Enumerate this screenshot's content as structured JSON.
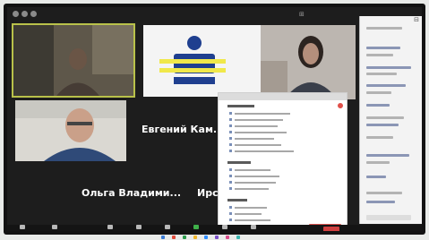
{
  "meeting": {
    "view_label": "⊞",
    "participants": [
      {
        "tile_name": "",
        "big_name": ""
      },
      {
        "tile_name": "",
        "big_name": "Евгений  Кам..."
      },
      {
        "tile_name": "",
        "big_name": ""
      },
      {
        "tile_name": "",
        "big_name": ""
      }
    ],
    "lower_names": {
      "left": "Ольга Владими...",
      "right": "Ирс"
    }
  },
  "chat": {
    "title": "⊟"
  },
  "toolbar": {
    "items": [
      {
        "icon": "microphone-icon"
      },
      {
        "icon": "video-camera-icon"
      },
      {
        "icon": "security-icon"
      },
      {
        "icon": "participants-icon"
      },
      {
        "icon": "chat-icon"
      },
      {
        "icon": "share-screen-icon"
      },
      {
        "icon": "record-icon"
      },
      {
        "icon": "reactions-icon"
      }
    ]
  },
  "colors": {
    "tile_border_active": "#b9c14a",
    "logo_blue": "#1f3f8f",
    "logo_yellow": "#f0e84a",
    "submit": "#d9534f"
  }
}
